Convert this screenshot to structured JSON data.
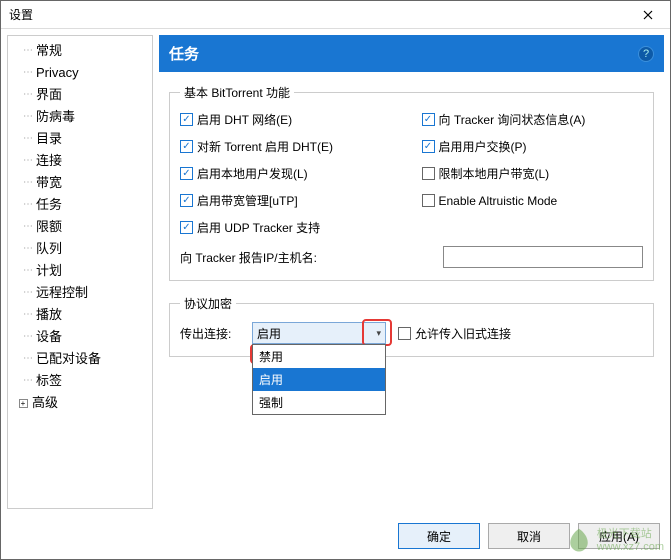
{
  "titlebar": {
    "title": "设置"
  },
  "sidebar": {
    "items": [
      {
        "label": "常规"
      },
      {
        "label": "Privacy"
      },
      {
        "label": "界面"
      },
      {
        "label": "防病毒"
      },
      {
        "label": "目录"
      },
      {
        "label": "连接"
      },
      {
        "label": "带宽"
      },
      {
        "label": "任务"
      },
      {
        "label": "限额"
      },
      {
        "label": "队列"
      },
      {
        "label": "计划"
      },
      {
        "label": "远程控制"
      },
      {
        "label": "播放"
      },
      {
        "label": "设备"
      },
      {
        "label": "已配对设备"
      },
      {
        "label": "标签"
      }
    ],
    "advanced": "高级"
  },
  "header": {
    "title": "任务",
    "help": "?"
  },
  "group_bt": {
    "legend": "基本 BitTorrent 功能",
    "dht": "启用 DHT 网络(E)",
    "tracker_status": "向 Tracker 询问状态信息(A)",
    "new_dht": "对新 Torrent 启用 DHT(E)",
    "pex": "启用用户交换(P)",
    "lpd": "启用本地用户发现(L)",
    "limit_lpd": "限制本地用户带宽(L)",
    "utp": "启用带宽管理[uTP]",
    "altruistic": "Enable Altruistic Mode",
    "udp_tracker": "启用 UDP Tracker 支持",
    "ip_label": "向 Tracker 报告IP/主机名:",
    "ip_value": ""
  },
  "group_enc": {
    "legend": "协议加密",
    "outgoing_label": "传出连接:",
    "outgoing_value": "启用",
    "options": {
      "disable": "禁用",
      "enable": "启用",
      "force": "强制"
    },
    "legacy": "允许传入旧式连接"
  },
  "buttons": {
    "ok": "确定",
    "cancel": "取消",
    "apply": "应用(A)"
  },
  "watermark": {
    "line1": "极光下载站",
    "line2": "www.xz7.com"
  }
}
